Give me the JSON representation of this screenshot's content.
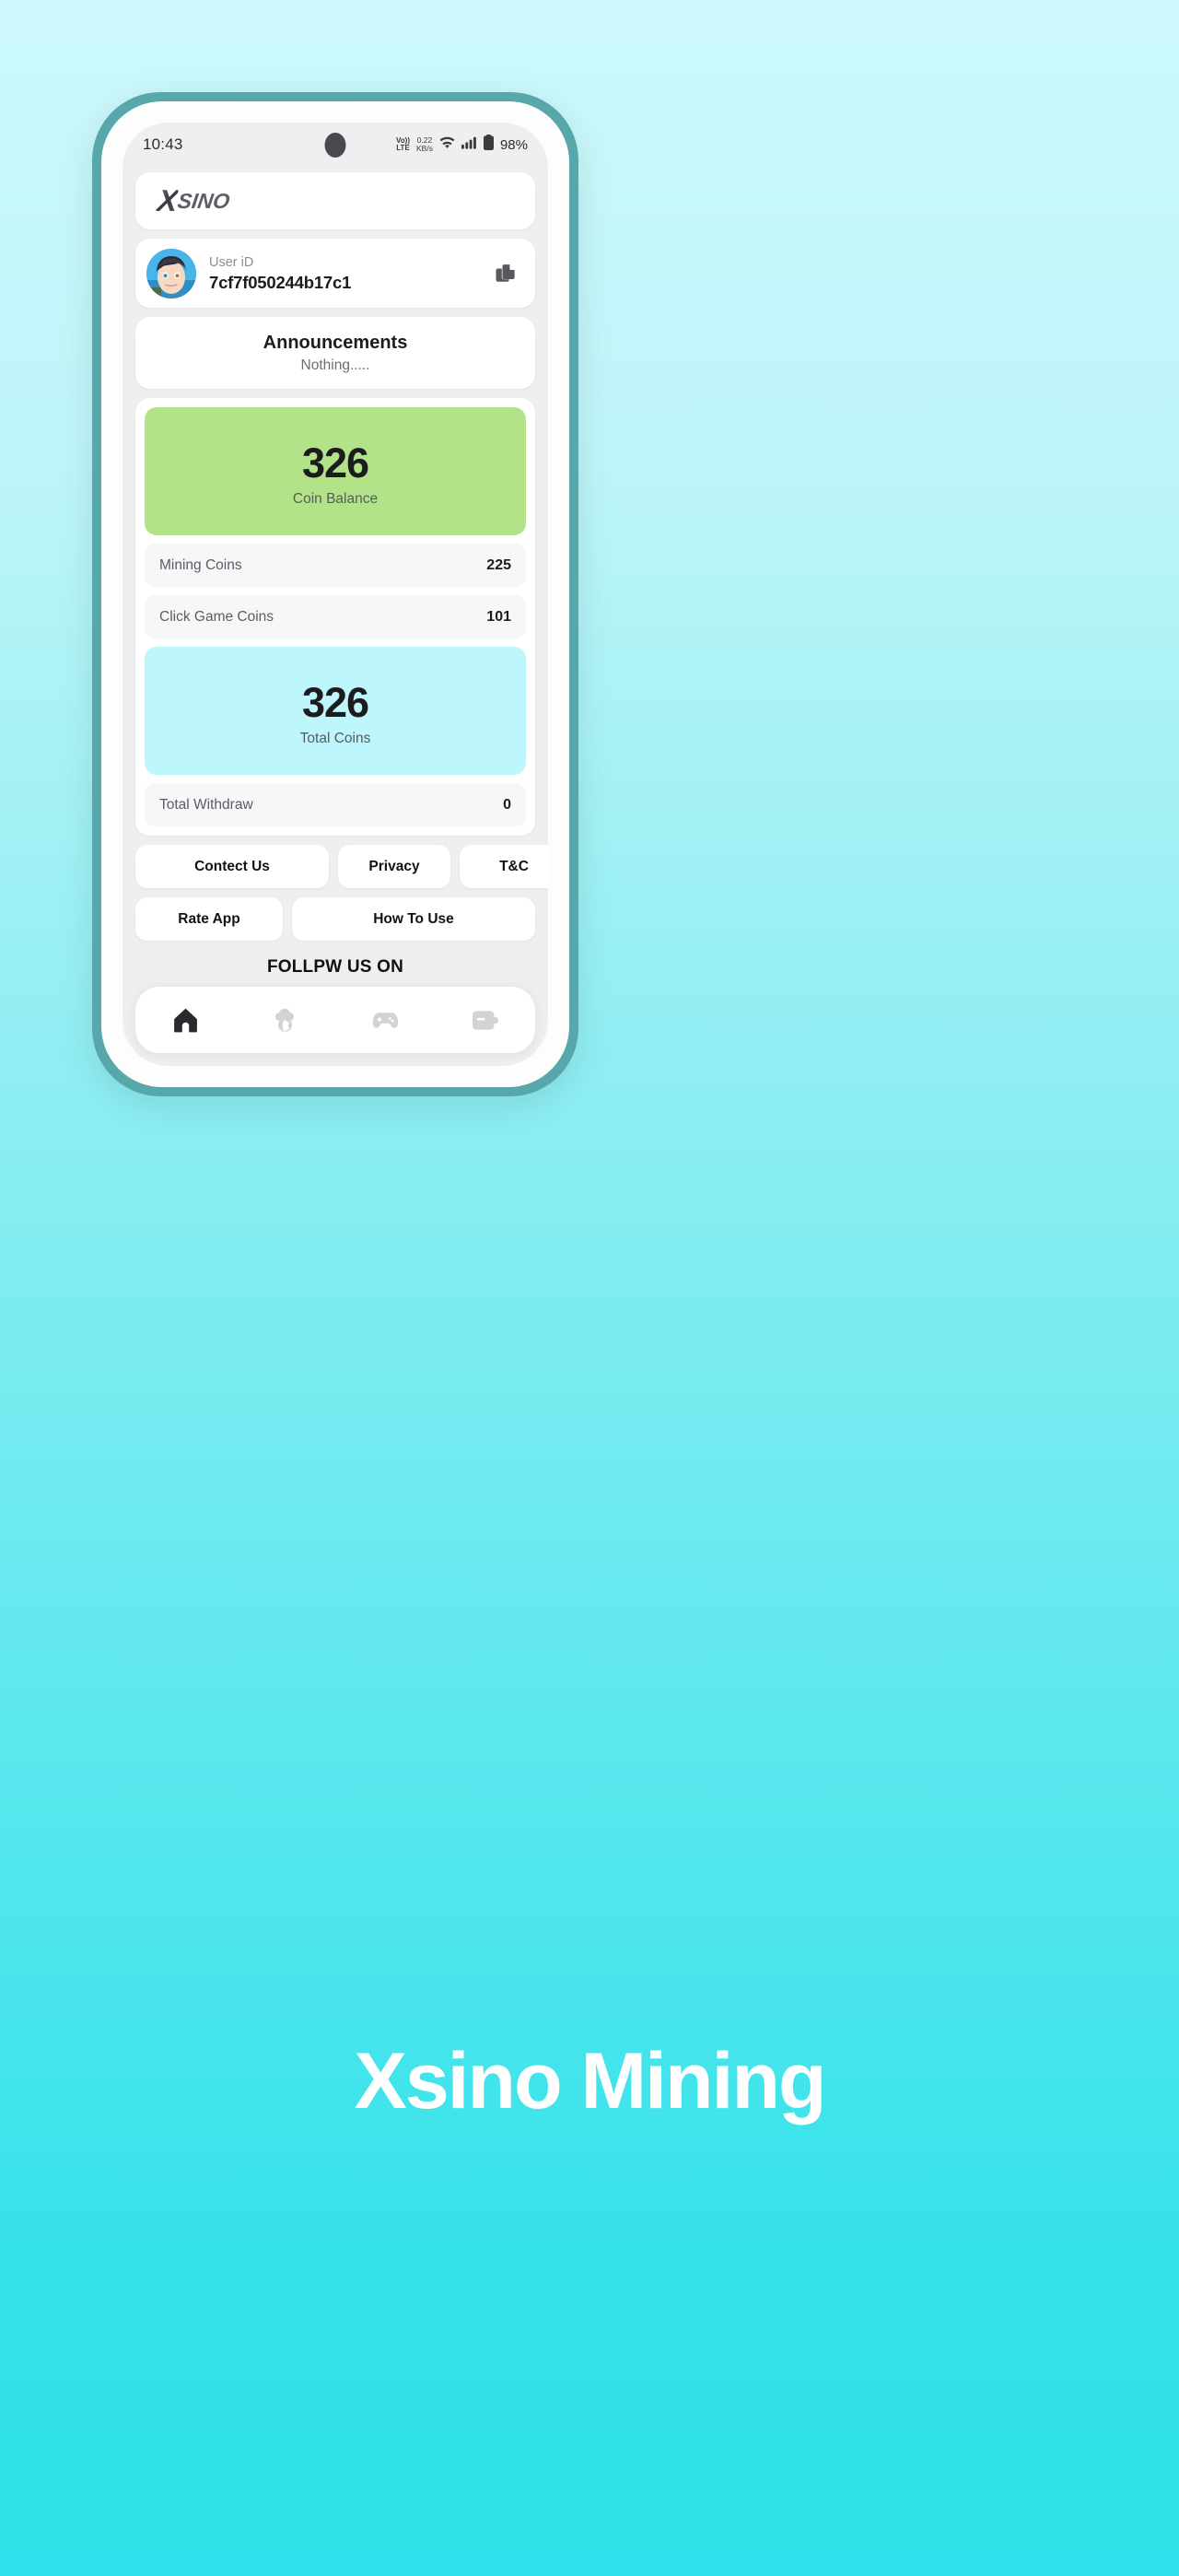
{
  "statusbar": {
    "time": "10:43",
    "volte_top": "Vo))",
    "volte_bottom": "LTE",
    "netspeed_value": "0.22",
    "netspeed_unit": "KB/s",
    "wifi_icon": "wifi-icon",
    "signal_icon": "cellular-signal-icon",
    "battery_icon": "battery-icon",
    "battery_percent": "98%"
  },
  "header": {
    "logo_x": "X",
    "logo_word": "SINO"
  },
  "user": {
    "label": "User iD",
    "value": "7cf7f050244b17c1",
    "copy_icon": "copy-icon",
    "avatar": "avatar"
  },
  "announcements": {
    "title": "Announcements",
    "body": "Nothing....."
  },
  "balance": {
    "coin_balance_value": "326",
    "coin_balance_label": "Coin Balance",
    "mining_label": "Mining Coins",
    "mining_value": "225",
    "click_game_label": "Click Game Coins",
    "click_game_value": "101",
    "total_coins_value": "326",
    "total_coins_label": "Total Coins",
    "withdraw_label": "Total Withdraw",
    "withdraw_value": "0",
    "green_card_color": "#b3e388",
    "cyan_card_color": "#bdf6fb"
  },
  "links": {
    "contact": "Contect Us",
    "privacy": "Privacy",
    "tc": "T&C",
    "rate": "Rate App",
    "how": "How To Use"
  },
  "follow": {
    "title": "FOLLPW US ON",
    "items": [
      {
        "icon": "facebook-icon"
      },
      {
        "icon": "telegram-icon"
      },
      {
        "icon": "youtube-icon"
      }
    ]
  },
  "navbar": {
    "items": [
      {
        "icon": "home-icon",
        "active": true
      },
      {
        "icon": "bitcoin-cloud-mining-icon",
        "active": false
      },
      {
        "icon": "gamepad-icon",
        "active": false
      },
      {
        "icon": "wallet-icon",
        "active": false
      }
    ]
  },
  "caption": {
    "text": "Xsino Mining"
  },
  "theme": {
    "frame_color": "#57a7ab",
    "background_top": "#cdf8fb",
    "background_bottom": "#2ee0e9"
  }
}
